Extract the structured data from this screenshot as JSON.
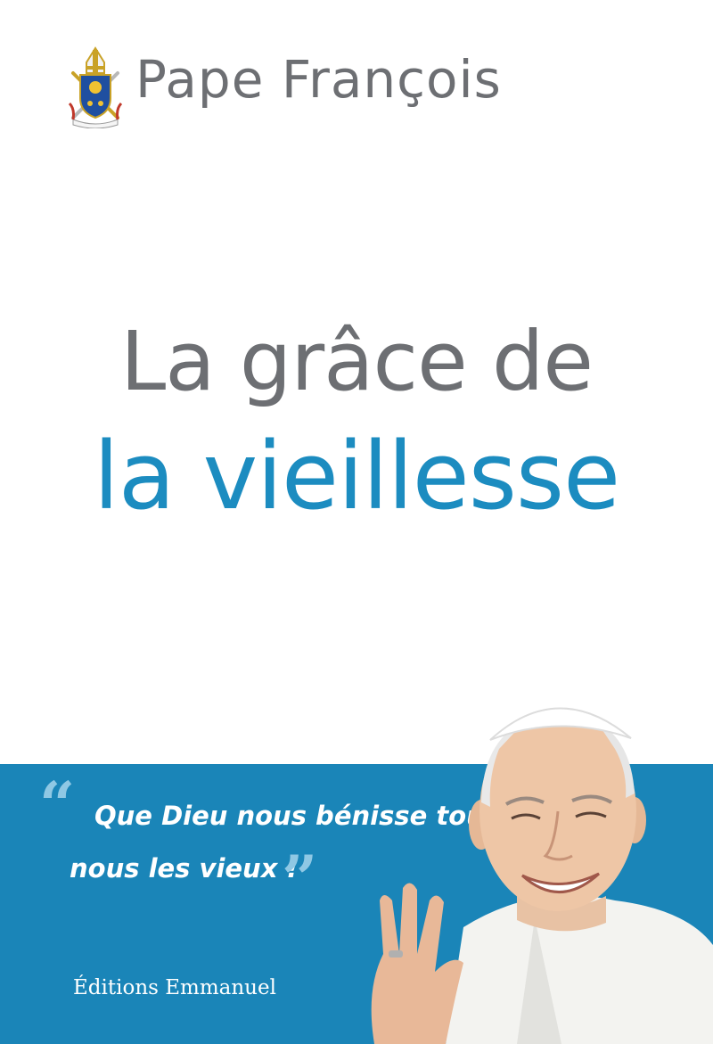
{
  "book": {
    "author": "Pape François",
    "title_line1": "La grâce de",
    "title_line2": "la vieillesse",
    "quote_open": "“",
    "quote_line1": "Que Dieu nous bénisse tous,",
    "quote_line2": "nous les vieux !",
    "quote_close": "”",
    "publisher": "Éditions Emmanuel"
  },
  "colors": {
    "band": "#1a85b8",
    "title_blue": "#1c8cc0",
    "title_gray": "#6d6f73",
    "quote_marks": "#8fc8e4"
  },
  "icons": {
    "coat_of_arms": "papal-coat-of-arms-icon"
  }
}
